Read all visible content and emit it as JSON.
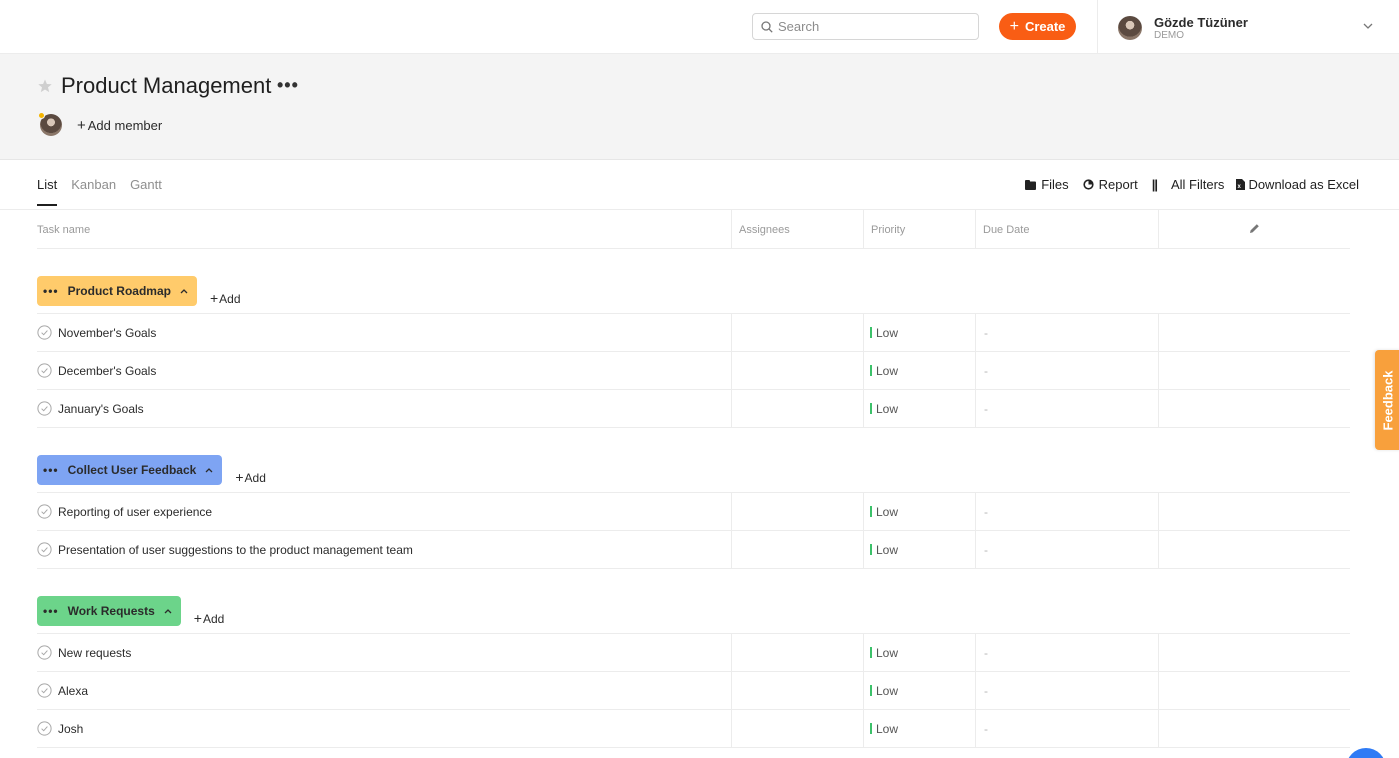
{
  "topbar": {
    "search_placeholder": "Search",
    "create_label": "Create",
    "user_name": "Gözde Tüzüner",
    "user_org": "DEMO"
  },
  "project": {
    "title": "Product Management",
    "more": "•••",
    "add_member_label": "Add member"
  },
  "tabs": [
    {
      "label": "List",
      "active": true
    },
    {
      "label": "Kanban",
      "active": false
    },
    {
      "label": "Gantt",
      "active": false
    }
  ],
  "actions": {
    "files": "Files",
    "report": "Report",
    "separator": "||",
    "all_filters": "All Filters",
    "download": "Download as Excel"
  },
  "columns": {
    "task_name": "Task name",
    "assignees": "Assignees",
    "priority": "Priority",
    "due_date": "Due Date"
  },
  "groups": [
    {
      "name": "Product Roadmap",
      "color": "#ffcb6b",
      "add_label": "Add",
      "tasks": [
        {
          "name": "November's Goals",
          "priority": "Low",
          "due": "-"
        },
        {
          "name": "December's Goals",
          "priority": "Low",
          "due": "-"
        },
        {
          "name": "January's Goals",
          "priority": "Low",
          "due": "-"
        }
      ]
    },
    {
      "name": "Collect User Feedback",
      "color": "#7ea4f3",
      "add_label": "Add",
      "tasks": [
        {
          "name": "Reporting of user experience",
          "priority": "Low",
          "due": "-"
        },
        {
          "name": "Presentation of user suggestions to the product management team",
          "priority": "Low",
          "due": "-"
        }
      ]
    },
    {
      "name": "Work Requests",
      "color": "#6cd48a",
      "add_label": "Add",
      "tasks": [
        {
          "name": "New requests",
          "priority": "Low",
          "due": "-"
        },
        {
          "name": "Alexa",
          "priority": "Low",
          "due": "-"
        },
        {
          "name": "Josh",
          "priority": "Low",
          "due": "-"
        }
      ]
    }
  ],
  "feedback_label": "Feedback",
  "colors": {
    "accent": "#f95d14",
    "priority_low": "#3cc16a",
    "feedback_tab": "#f8a03c"
  }
}
